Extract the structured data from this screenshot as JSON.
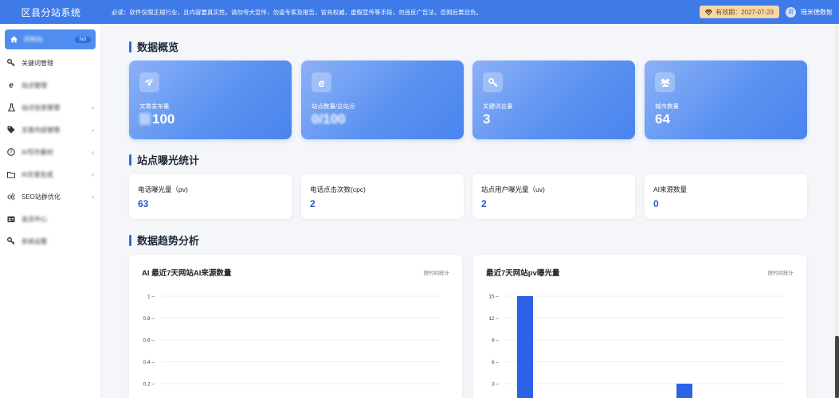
{
  "header": {
    "brand": "区县分站系统",
    "notice": "必读：软件仅限正规行业，且内容要真实性。请勿夸大宣传，勿盗专家及报告，冒充权威，虚假宣传等手段，勿违反广告法，否则后果自负。",
    "expire_label": "有效期：2027-07-23",
    "user_name": "瑶米德数智",
    "avatar_text": "用"
  },
  "sidebar": {
    "items": [
      {
        "label": "控制台",
        "badge": "hot",
        "icon": "home-icon",
        "active": true
      },
      {
        "label": "关键词管理",
        "icon": "key-icon"
      },
      {
        "label": "站点管理",
        "icon": "ie-icon"
      },
      {
        "label": "站点信息管理",
        "icon": "flask-icon",
        "chevron": "‹"
      },
      {
        "label": "文章内容管理",
        "icon": "tag-icon",
        "chevron": "‹"
      },
      {
        "label": "AI写作素材",
        "icon": "question-icon",
        "chevron": "‹"
      },
      {
        "label": "AI文章生成",
        "icon": "folder-icon",
        "chevron": "‹"
      },
      {
        "label": "SEO站群优化",
        "icon": "cogs-icon",
        "chevron": "‹"
      },
      {
        "label": "会员中心",
        "icon": "id-card-icon"
      },
      {
        "label": "系统设置",
        "icon": "key-icon"
      }
    ]
  },
  "overview": {
    "title": "数据概览",
    "cards": [
      {
        "label": "文章发布量",
        "value": "100",
        "icon": "paper-plane-icon"
      },
      {
        "label": "站点数量/总站点",
        "value": "0/100",
        "icon": "ie-icon"
      },
      {
        "label": "关键词总量",
        "value": "3",
        "icon": "key-icon"
      },
      {
        "label": "城市数量",
        "value": "64",
        "icon": "users-icon"
      }
    ]
  },
  "exposure": {
    "title": "站点曝光统计",
    "cards": [
      {
        "label": "电话曝光量（pv)",
        "value": "63"
      },
      {
        "label": "电话点击次数(cpc)",
        "value": "2"
      },
      {
        "label": "站点用户曝光量（uv)",
        "value": "2"
      },
      {
        "label": "AI来源数量",
        "value": "0"
      }
    ]
  },
  "trend": {
    "title": "数据趋势分析",
    "panels": [
      {
        "title": "AI 最近7天网站AI来源数量",
        "sub": "按时间统计"
      },
      {
        "title": "最近7天网站pv曝光量",
        "sub": "按时间统计"
      }
    ]
  },
  "chart_data": [
    {
      "type": "bar",
      "title": "AI 最近7天网站AI来源数量",
      "ylim": [
        0,
        1
      ],
      "yticks": [
        "1",
        "0.8",
        "0.6",
        "0.4",
        "0.2"
      ],
      "values": [
        0,
        0,
        0,
        0,
        0,
        0,
        0
      ],
      "grid": true
    },
    {
      "type": "bar",
      "title": "最近7天网站pv曝光量",
      "ylim": [
        0,
        15
      ],
      "yticks": [
        "15",
        "12",
        "9",
        "6",
        "3"
      ],
      "values": [
        15,
        0,
        0,
        0,
        3,
        0,
        0
      ],
      "color": "#2d62e6",
      "grid": true
    }
  ]
}
